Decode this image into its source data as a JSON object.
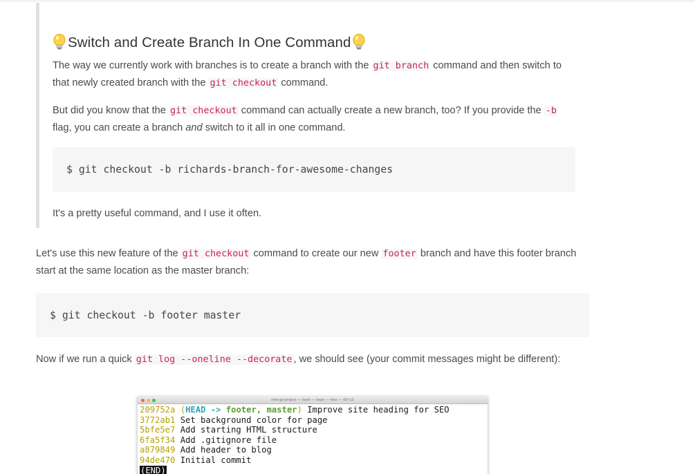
{
  "callout": {
    "title": "Switch and Create Branch In One Command",
    "p1": {
      "a": "The way we currently work with branches is to create a branch with the",
      "code1": "git branch",
      "b": "command and then switch to",
      "c": "that newly created branch with the",
      "code2": "git checkout",
      "d": "command."
    },
    "p2": {
      "a": "But did you know that the",
      "code1": "git checkout",
      "b": "command can actually create a new branch, too? If you provide the",
      "code2": "-b",
      "c": "flag, you can create a branch",
      "em": "and",
      "d": "switch to it all in one command."
    },
    "code": "$ git checkout -b richards-branch-for-awesome-changes",
    "p3": "It's a pretty useful command, and I use it often."
  },
  "main": {
    "p1": {
      "a": "Let's use this new feature of the",
      "code1": "git checkout",
      "b": "command to create our new",
      "code2": "footer",
      "c": "branch and have this footer branch",
      "d": "start at the same location as the master branch:"
    },
    "code": "$ git checkout -b footer master",
    "p2": {
      "a": "Now if we run a quick",
      "code1": "git log --oneline --decorate",
      "b": ", we should see (your commit messages might be different):"
    }
  },
  "terminal": {
    "title": "new-git-project — bash — bash — less — 66×12",
    "dot_colors": [
      "#fc605c",
      "#fdbc40",
      "#34c84a"
    ],
    "first": {
      "hash": "209752a",
      "open": " (",
      "head": "HEAD ->",
      "branches": "footer, master",
      "close": ")",
      "msg": " Improve site heading for SEO"
    },
    "commits": [
      {
        "hash": "3772ab1",
        "msg": " Set background color for page"
      },
      {
        "hash": "5bfe5e7",
        "msg": " Add starting HTML structure"
      },
      {
        "hash": "6fa5f34",
        "msg": " Add .gitignore file"
      },
      {
        "hash": "a879849",
        "msg": " Add header to blog"
      },
      {
        "hash": "94de470",
        "msg": " Initial commit"
      }
    ],
    "end": "(END)"
  }
}
